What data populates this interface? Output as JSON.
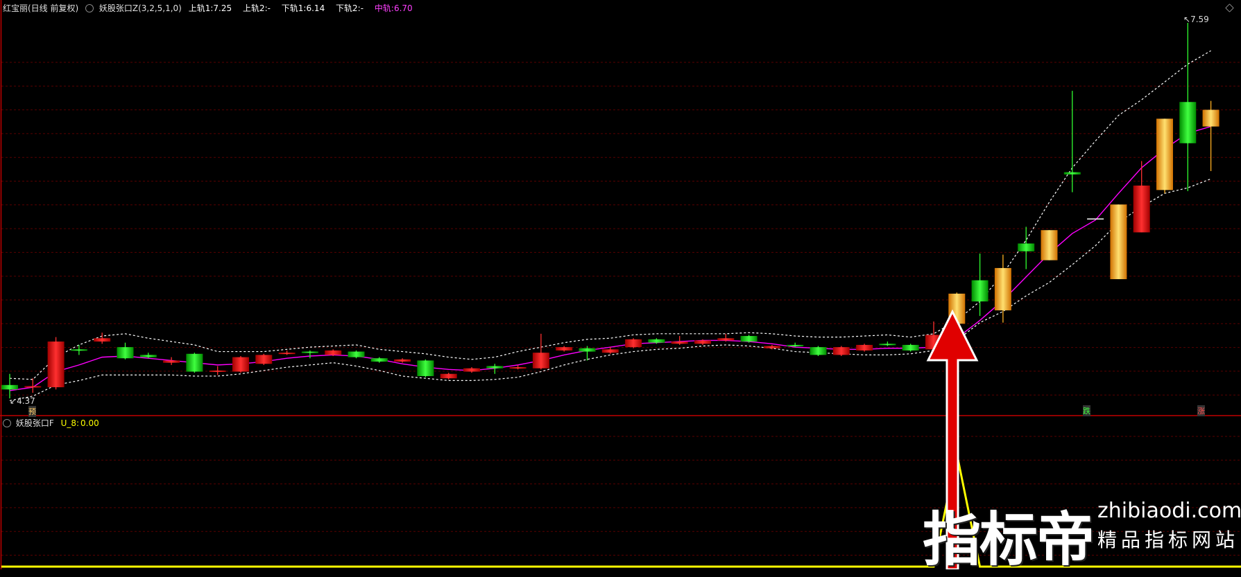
{
  "header": {
    "stock": "红宝丽(日线 前复权)",
    "indicator": "妖股张口Z(3,2,5,1,0)",
    "up1_label": "上轨1:",
    "up1_value": "7.25",
    "up2_label": "上轨2:",
    "up2_value": "-",
    "dn1_label": "下轨1:",
    "dn1_value": "6.14",
    "dn2_label": "下轨2:",
    "dn2_value": "-",
    "mid_label": "中轨:",
    "mid_value": "6.70"
  },
  "sub_header": {
    "indicator": "妖股张口F",
    "u8_label": "U_8:",
    "u8_value": "0.00"
  },
  "markers": {
    "high": "7.59",
    "low": "4.37",
    "pre": "预",
    "drop": "跌",
    "rise": "涨"
  },
  "watermark": {
    "brand": "指标帝",
    "url": "zhibiaodi.com",
    "slogan": "精品指标网站"
  },
  "colors": {
    "up": "#ff2020",
    "down": "#00e020",
    "special": "#ffa500",
    "mid": "#ff00ff",
    "band": "#ffffff",
    "grid": "#5a0000",
    "signal": "#ffff00",
    "arrow": "#ff1010"
  },
  "chart_data": {
    "type": "candlestick",
    "ylim": [
      4.2,
      7.7
    ],
    "candles": [
      {
        "o": 4.4,
        "c": 4.36,
        "h": 4.5,
        "l": 4.28,
        "col": "down"
      },
      {
        "o": 4.38,
        "c": 4.39,
        "h": 4.46,
        "l": 4.33,
        "col": "up"
      },
      {
        "o": 4.38,
        "c": 4.79,
        "h": 4.83,
        "l": 4.36,
        "col": "up"
      },
      {
        "o": 4.72,
        "c": 4.71,
        "h": 4.76,
        "l": 4.67,
        "col": "down"
      },
      {
        "o": 4.79,
        "c": 4.82,
        "h": 4.87,
        "l": 4.77,
        "col": "up"
      },
      {
        "o": 4.74,
        "c": 4.64,
        "h": 4.78,
        "l": 4.63,
        "col": "down"
      },
      {
        "o": 4.67,
        "c": 4.65,
        "h": 4.69,
        "l": 4.64,
        "col": "down"
      },
      {
        "o": 4.6,
        "c": 4.62,
        "h": 4.65,
        "l": 4.58,
        "col": "up"
      },
      {
        "o": 4.68,
        "c": 4.52,
        "h": 4.69,
        "l": 4.51,
        "col": "down"
      },
      {
        "o": 4.52,
        "c": 4.53,
        "h": 4.57,
        "l": 4.49,
        "col": "up"
      },
      {
        "o": 4.52,
        "c": 4.65,
        "h": 4.66,
        "l": 4.51,
        "col": "up"
      },
      {
        "o": 4.59,
        "c": 4.67,
        "h": 4.68,
        "l": 4.58,
        "col": "up"
      },
      {
        "o": 4.69,
        "c": 4.69,
        "h": 4.71,
        "l": 4.67,
        "col": "up"
      },
      {
        "o": 4.7,
        "c": 4.69,
        "h": 4.71,
        "l": 4.64,
        "col": "down"
      },
      {
        "o": 4.67,
        "c": 4.71,
        "h": 4.72,
        "l": 4.66,
        "col": "up"
      },
      {
        "o": 4.7,
        "c": 4.65,
        "h": 4.71,
        "l": 4.64,
        "col": "down"
      },
      {
        "o": 4.64,
        "c": 4.61,
        "h": 4.65,
        "l": 4.6,
        "col": "down"
      },
      {
        "o": 4.63,
        "c": 4.61,
        "h": 4.64,
        "l": 4.6,
        "col": "up"
      },
      {
        "o": 4.62,
        "c": 4.48,
        "h": 4.63,
        "l": 4.47,
        "col": "down"
      },
      {
        "o": 4.5,
        "c": 4.46,
        "h": 4.51,
        "l": 4.45,
        "col": "up"
      },
      {
        "o": 4.55,
        "c": 4.52,
        "h": 4.56,
        "l": 4.51,
        "col": "up"
      },
      {
        "o": 4.57,
        "c": 4.55,
        "h": 4.59,
        "l": 4.5,
        "col": "down"
      },
      {
        "o": 4.56,
        "c": 4.56,
        "h": 4.58,
        "l": 4.54,
        "col": "up"
      },
      {
        "o": 4.55,
        "c": 4.69,
        "h": 4.86,
        "l": 4.54,
        "col": "up"
      },
      {
        "o": 4.71,
        "c": 4.74,
        "h": 4.75,
        "l": 4.7,
        "col": "up"
      },
      {
        "o": 4.73,
        "c": 4.7,
        "h": 4.75,
        "l": 4.62,
        "col": "down"
      },
      {
        "o": 4.69,
        "c": 4.72,
        "h": 4.74,
        "l": 4.68,
        "col": "up"
      },
      {
        "o": 4.74,
        "c": 4.81,
        "h": 4.82,
        "l": 4.73,
        "col": "up"
      },
      {
        "o": 4.81,
        "c": 4.78,
        "h": 4.82,
        "l": 4.77,
        "col": "down"
      },
      {
        "o": 4.77,
        "c": 4.79,
        "h": 4.84,
        "l": 4.76,
        "col": "up"
      },
      {
        "o": 4.77,
        "c": 4.8,
        "h": 4.81,
        "l": 4.76,
        "col": "up"
      },
      {
        "o": 4.8,
        "c": 4.82,
        "h": 4.86,
        "l": 4.79,
        "col": "up"
      },
      {
        "o": 4.84,
        "c": 4.79,
        "h": 4.85,
        "l": 4.78,
        "col": "down"
      },
      {
        "o": 4.73,
        "c": 4.75,
        "h": 4.76,
        "l": 4.72,
        "col": "up"
      },
      {
        "o": 4.76,
        "c": 4.76,
        "h": 4.78,
        "l": 4.74,
        "col": "down"
      },
      {
        "o": 4.74,
        "c": 4.67,
        "h": 4.75,
        "l": 4.66,
        "col": "down"
      },
      {
        "o": 4.74,
        "c": 4.67,
        "h": 4.75,
        "l": 4.66,
        "col": "up"
      },
      {
        "o": 4.71,
        "c": 4.76,
        "h": 4.77,
        "l": 4.7,
        "col": "up"
      },
      {
        "o": 4.76,
        "c": 4.77,
        "h": 4.79,
        "l": 4.75,
        "col": "down"
      },
      {
        "o": 4.76,
        "c": 4.71,
        "h": 4.77,
        "l": 4.7,
        "col": "down"
      },
      {
        "o": 4.72,
        "c": 4.85,
        "h": 4.97,
        "l": 4.71,
        "col": "up"
      },
      {
        "o": 4.95,
        "c": 5.22,
        "h": 5.23,
        "l": 4.94,
        "col": "special"
      },
      {
        "o": 5.34,
        "c": 5.15,
        "h": 5.58,
        "l": 5.02,
        "col": "down"
      },
      {
        "o": 5.07,
        "c": 5.45,
        "h": 5.57,
        "l": 4.96,
        "col": "special"
      },
      {
        "o": 5.67,
        "c": 5.6,
        "h": 5.82,
        "l": 5.44,
        "col": "down"
      },
      {
        "o": 5.79,
        "c": 5.52,
        "h": 5.79,
        "l": 5.52,
        "col": "special"
      },
      {
        "o": 6.29,
        "c": 6.31,
        "h": 7.04,
        "l": 6.13,
        "col": "down"
      },
      {
        "o": 5.89,
        "c": 5.89,
        "h": 5.89,
        "l": 5.89,
        "col": "dash"
      },
      {
        "o": 5.35,
        "c": 6.02,
        "h": 6.02,
        "l": 5.35,
        "col": "special"
      },
      {
        "o": 5.77,
        "c": 6.19,
        "h": 6.41,
        "l": 5.77,
        "col": "up"
      },
      {
        "o": 6.15,
        "c": 6.79,
        "h": 6.79,
        "l": 6.12,
        "col": "special"
      },
      {
        "o": 6.57,
        "c": 6.94,
        "h": 7.65,
        "l": 6.14,
        "col": "down"
      },
      {
        "o": 6.72,
        "c": 6.87,
        "h": 6.95,
        "l": 6.32,
        "col": "special"
      }
    ],
    "upper_band": [
      4.46,
      4.45,
      4.65,
      4.76,
      4.84,
      4.86,
      4.82,
      4.79,
      4.76,
      4.7,
      4.7,
      4.7,
      4.72,
      4.74,
      4.75,
      4.76,
      4.72,
      4.7,
      4.68,
      4.65,
      4.63,
      4.65,
      4.7,
      4.74,
      4.78,
      4.81,
      4.82,
      4.85,
      4.86,
      4.86,
      4.86,
      4.86,
      4.87,
      4.86,
      4.84,
      4.83,
      4.83,
      4.84,
      4.85,
      4.83,
      4.86,
      4.98,
      5.15,
      5.4,
      5.7,
      6.04,
      6.35,
      6.59,
      6.82,
      6.96,
      7.12,
      7.28,
      7.4
    ],
    "mid_band": [
      4.35,
      4.38,
      4.52,
      4.58,
      4.65,
      4.66,
      4.64,
      4.62,
      4.6,
      4.58,
      4.59,
      4.61,
      4.64,
      4.66,
      4.67,
      4.66,
      4.63,
      4.59,
      4.56,
      4.54,
      4.53,
      4.55,
      4.58,
      4.62,
      4.67,
      4.71,
      4.74,
      4.77,
      4.78,
      4.79,
      4.8,
      4.8,
      4.79,
      4.77,
      4.74,
      4.73,
      4.72,
      4.72,
      4.73,
      4.73,
      4.74,
      4.82,
      4.98,
      5.16,
      5.37,
      5.58,
      5.76,
      5.88,
      6.12,
      6.35,
      6.52,
      6.66,
      6.72
    ],
    "lower_band": [
      4.26,
      4.3,
      4.4,
      4.44,
      4.49,
      4.49,
      4.49,
      4.49,
      4.48,
      4.48,
      4.5,
      4.53,
      4.56,
      4.58,
      4.6,
      4.57,
      4.53,
      4.48,
      4.46,
      4.44,
      4.44,
      4.45,
      4.47,
      4.52,
      4.58,
      4.63,
      4.67,
      4.7,
      4.72,
      4.73,
      4.75,
      4.76,
      4.75,
      4.73,
      4.7,
      4.69,
      4.68,
      4.67,
      4.67,
      4.68,
      4.71,
      4.8,
      4.96,
      5.06,
      5.2,
      5.32,
      5.48,
      5.65,
      5.86,
      6.0,
      6.12,
      6.17,
      6.25
    ],
    "signal": [
      0,
      0,
      0,
      0,
      0,
      0,
      0,
      0,
      0,
      0,
      0,
      0,
      0,
      0,
      0,
      0,
      0,
      0,
      0,
      0,
      0,
      0,
      0,
      0,
      0,
      0,
      0,
      0,
      0,
      0,
      0,
      0,
      0,
      0,
      0,
      0,
      0,
      0,
      0,
      0,
      0,
      1,
      0,
      0,
      0,
      0,
      0,
      0,
      0,
      0,
      0,
      0,
      0
    ]
  }
}
